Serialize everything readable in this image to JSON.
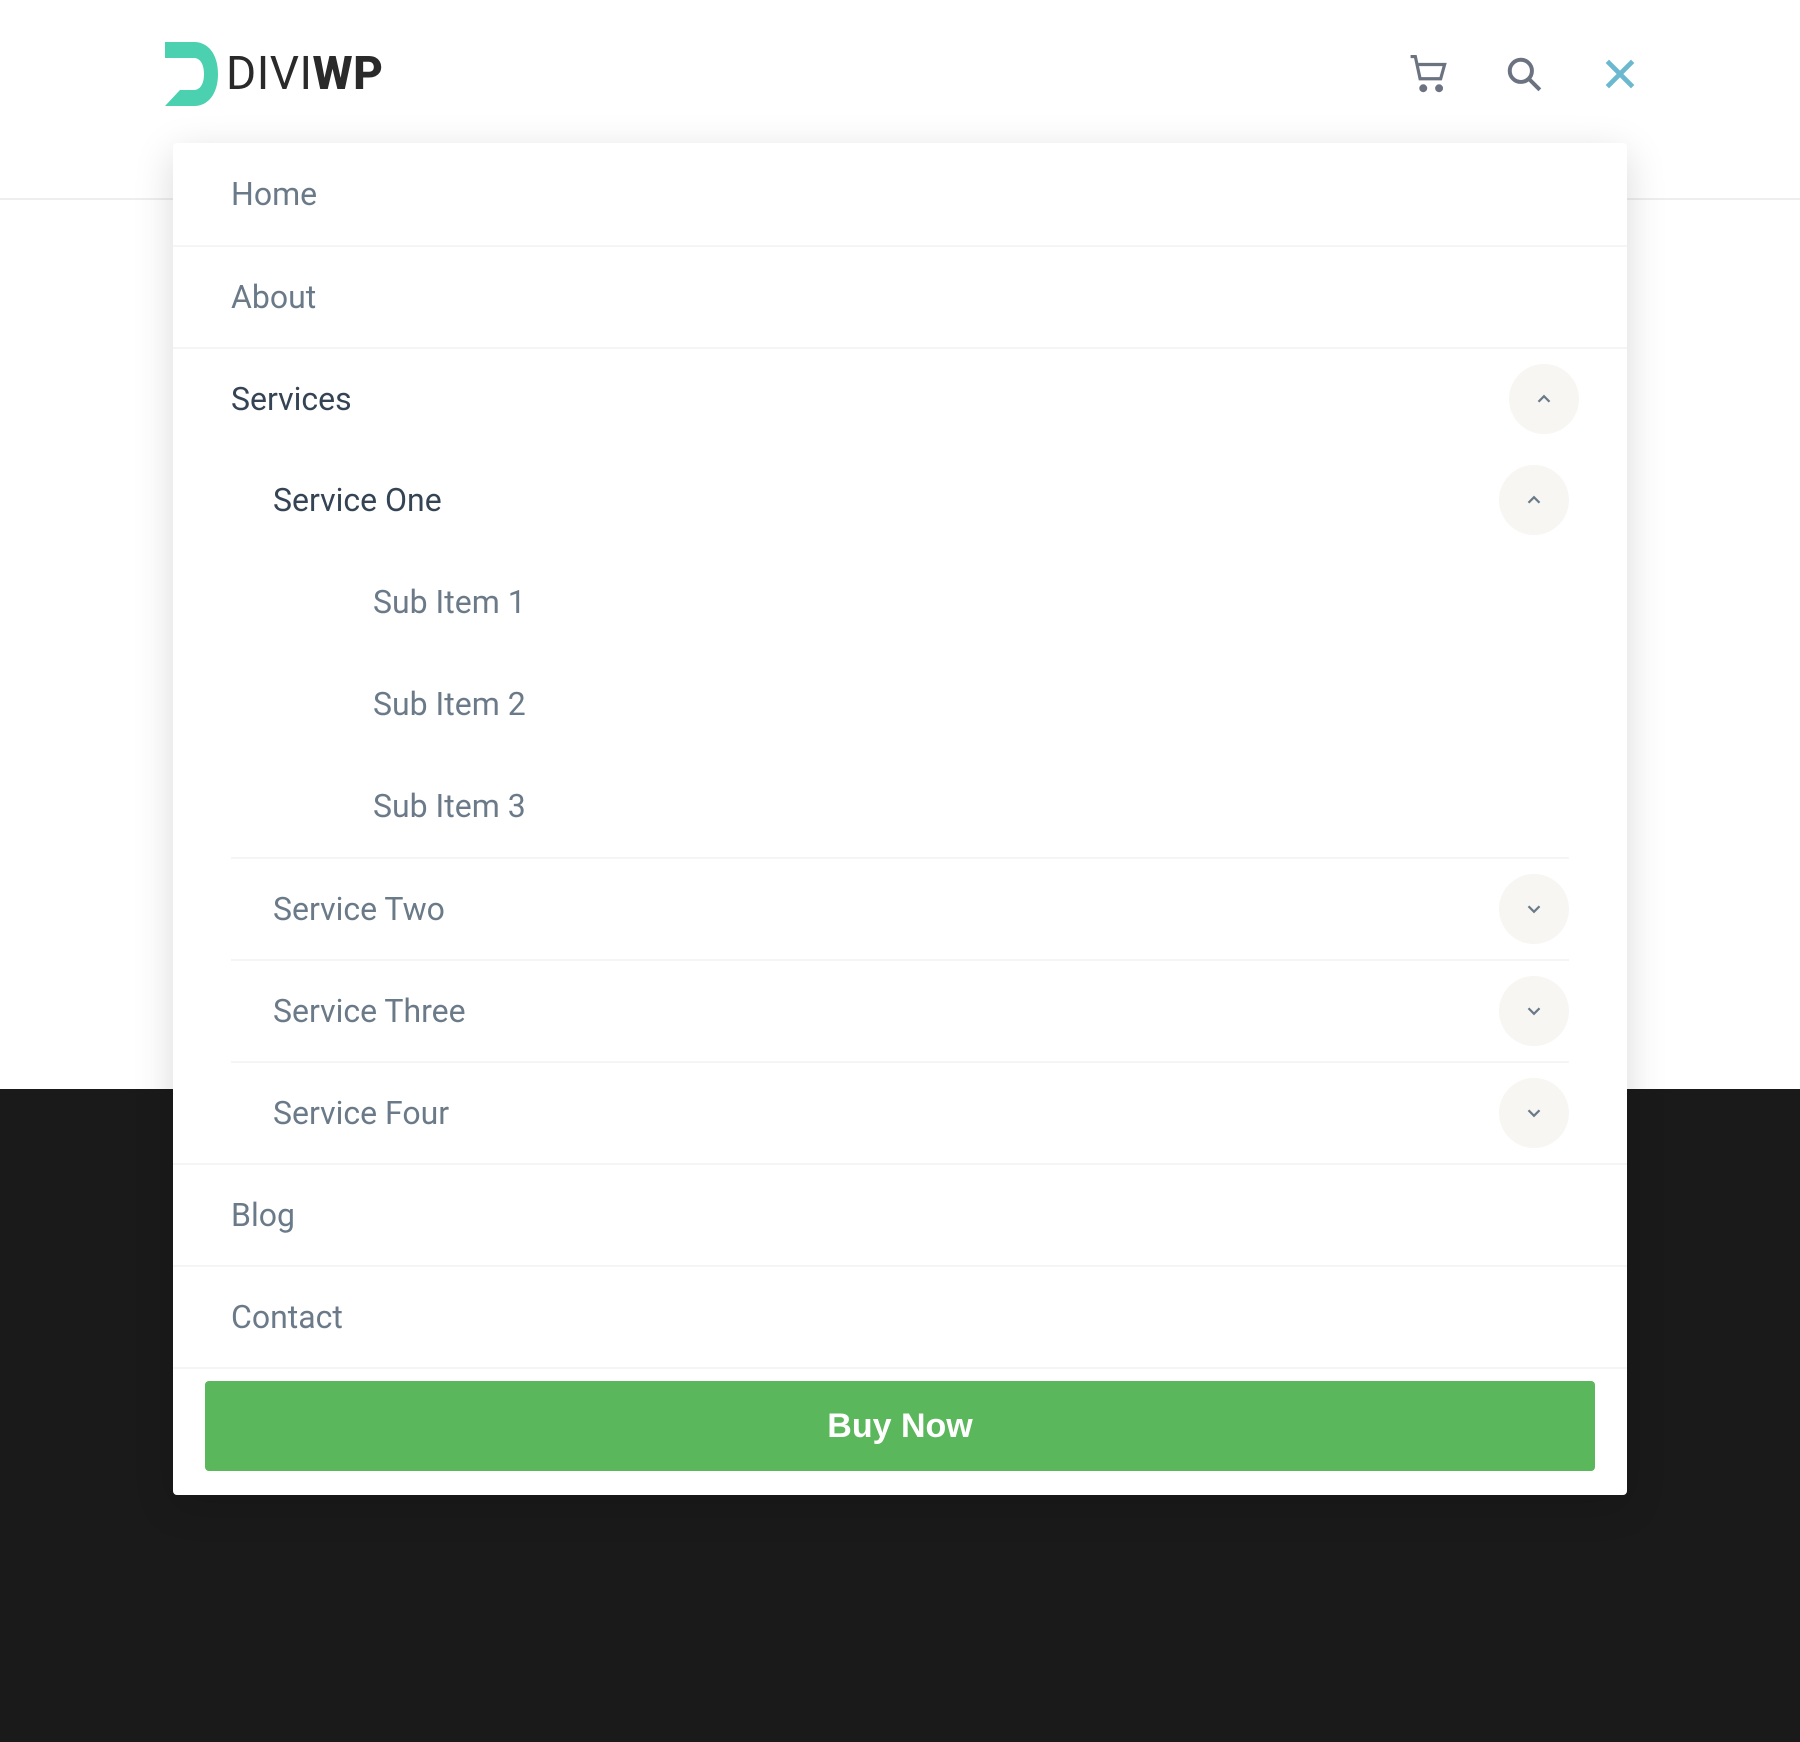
{
  "logo": {
    "name_a": "DIVI",
    "name_b": "WP",
    "accent": "#4bd0b0"
  },
  "nav": {
    "items": [
      {
        "label": "Home"
      },
      {
        "label": "About"
      },
      {
        "label": "Services",
        "expanded": true,
        "children": [
          {
            "label": "Service One",
            "expanded": true,
            "children": [
              {
                "label": "Sub Item 1"
              },
              {
                "label": "Sub Item 2"
              },
              {
                "label": "Sub Item 3"
              }
            ]
          },
          {
            "label": "Service Two",
            "expanded": false
          },
          {
            "label": "Service Three",
            "expanded": false
          },
          {
            "label": "Service Four",
            "expanded": false
          }
        ]
      },
      {
        "label": "Blog"
      },
      {
        "label": "Contact"
      }
    ],
    "cta": "Buy Now"
  }
}
